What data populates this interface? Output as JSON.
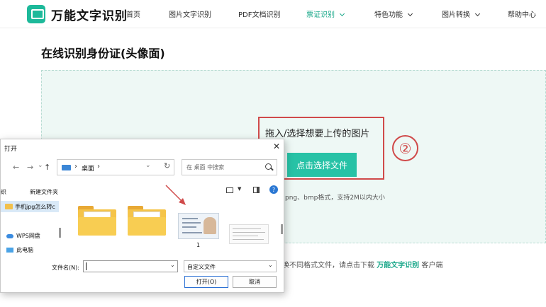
{
  "app": {
    "name": "万能文字识别"
  },
  "nav": {
    "home": "首页",
    "image_text": "图片文字识别",
    "pdf_text": "PDF文档识别",
    "ticket_id": "票证识别",
    "features": "特色功能",
    "image_convert": "图片转换",
    "help": "帮助中心"
  },
  "page": {
    "title": "在线识别身份证(头像面)",
    "drop_hint": "拖入/选择想要上传的图片",
    "choose_file": "点击选择文件",
    "format_hint": "png、bmp格式，支持2M以内大小",
    "bottom_prefix": "换不同格式文件，请点击下载",
    "bottom_link": "万能文字识别",
    "bottom_suffix": "客户端",
    "annotation_number": "②"
  },
  "dialog": {
    "title": "打开",
    "address_folder": "桌面",
    "search_placeholder": "在 桌面 中搜索",
    "organize_partial": "组织",
    "new_folder": "新建文件夹",
    "sidebar": [
      {
        "label": "手机jpg怎么转c"
      },
      {
        "label": "WPS网盘"
      },
      {
        "label": "此电脑"
      }
    ],
    "file_label": "1",
    "filename_label": "文件名(N):",
    "filename_value": "",
    "filetype_value": "自定义文件",
    "open_button": "打开(O)",
    "cancel_button": "取消"
  },
  "colors": {
    "brand": "#1db99a",
    "button": "#27c2a6",
    "upload_bg": "#eef8f5",
    "annotation_red": "#d04a4a"
  }
}
